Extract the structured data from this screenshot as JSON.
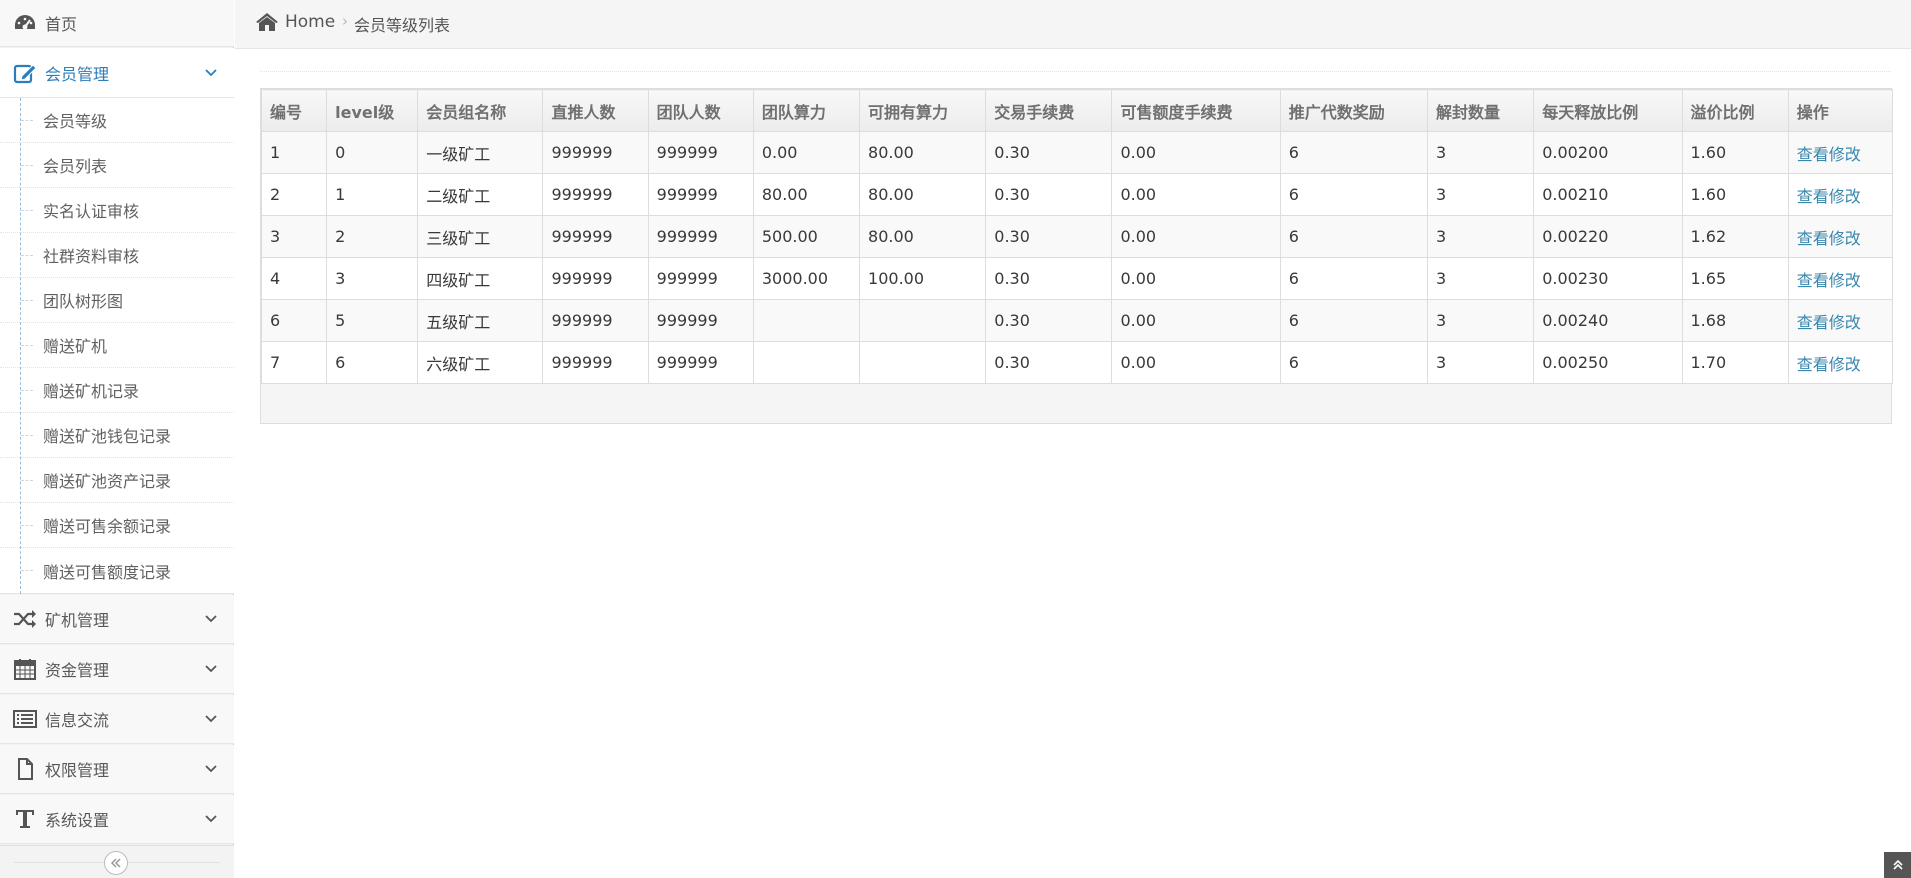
{
  "sidebar": {
    "home": {
      "label": "首页",
      "icon": "dashboard-icon"
    },
    "member": {
      "label": "会员管理",
      "icon": "edit-icon",
      "items": [
        {
          "label": "会员等级"
        },
        {
          "label": "会员列表"
        },
        {
          "label": "实名认证审核"
        },
        {
          "label": "社群资料审核"
        },
        {
          "label": "团队树形图"
        },
        {
          "label": "赠送矿机"
        },
        {
          "label": "赠送矿机记录"
        },
        {
          "label": "赠送矿池钱包记录"
        },
        {
          "label": "赠送矿池资产记录"
        },
        {
          "label": "赠送可售余额记录"
        },
        {
          "label": "赠送可售额度记录"
        }
      ]
    },
    "groups": [
      {
        "label": "矿机管理",
        "icon": "shuffle-icon"
      },
      {
        "label": "资金管理",
        "icon": "calendar-icon"
      },
      {
        "label": "信息交流",
        "icon": "list-icon"
      },
      {
        "label": "权限管理",
        "icon": "file-icon"
      },
      {
        "label": "系统设置",
        "icon": "text-icon"
      }
    ],
    "collapse_icon": "double-angle-left-icon"
  },
  "breadcrumb": {
    "home_label": "Home",
    "separator": "›",
    "current": "会员等级列表"
  },
  "table": {
    "headers": [
      "编号",
      "level级",
      "会员组名称",
      "直推人数",
      "团队人数",
      "团队算力",
      "可拥有算力",
      "交易手续费",
      "可售额度手续费",
      "推广代数奖励",
      "解封数量",
      "每天释放比例",
      "溢价比例",
      "操作"
    ],
    "rows": [
      [
        "1",
        "0",
        "一级矿工",
        "999999",
        "999999",
        "0.00",
        "80.00",
        "0.30",
        "0.00",
        "6",
        "3",
        "0.00200",
        "1.60",
        "查看修改"
      ],
      [
        "2",
        "1",
        "二级矿工",
        "999999",
        "999999",
        "80.00",
        "80.00",
        "0.30",
        "0.00",
        "6",
        "3",
        "0.00210",
        "1.60",
        "查看修改"
      ],
      [
        "3",
        "2",
        "三级矿工",
        "999999",
        "999999",
        "500.00",
        "80.00",
        "0.30",
        "0.00",
        "6",
        "3",
        "0.00220",
        "1.62",
        "查看修改"
      ],
      [
        "4",
        "3",
        "四级矿工",
        "999999",
        "999999",
        "3000.00",
        "100.00",
        "0.30",
        "0.00",
        "6",
        "3",
        "0.00230",
        "1.65",
        "查看修改"
      ],
      [
        "6",
        "5",
        "五级矿工",
        "999999",
        "999999",
        "",
        "",
        "0.30",
        "0.00",
        "6",
        "3",
        "0.00240",
        "1.68",
        "查看修改"
      ],
      [
        "7",
        "6",
        "六级矿工",
        "999999",
        "999999",
        "",
        "",
        "0.30",
        "0.00",
        "6",
        "3",
        "0.00250",
        "1.70",
        "查看修改"
      ]
    ]
  },
  "scroll_top_icon": "double-angle-up-icon",
  "colors": {
    "accent": "#2b7dbc",
    "link": "#3a87ad"
  }
}
